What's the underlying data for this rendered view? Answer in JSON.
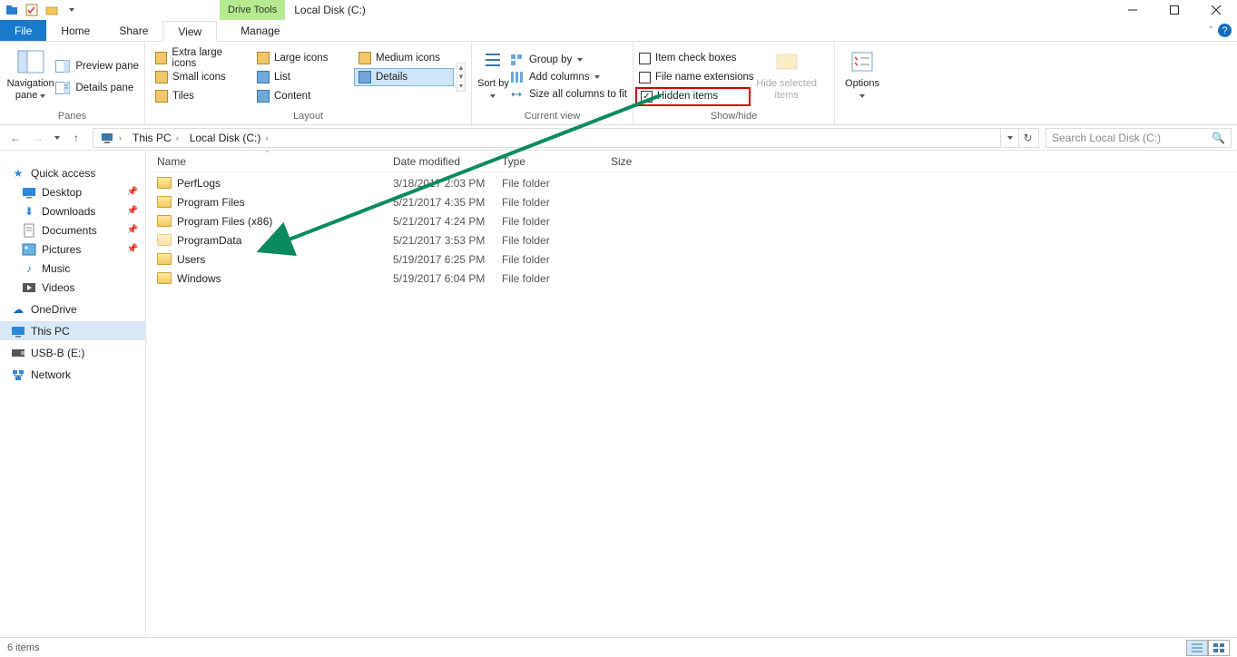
{
  "window": {
    "drive_tools_label": "Drive Tools",
    "title": "Local Disk (C:)"
  },
  "tabs": {
    "file": "File",
    "home": "Home",
    "share": "Share",
    "view": "View",
    "manage": "Manage"
  },
  "ribbon": {
    "panes": {
      "nav_pane": "Navigation pane",
      "preview": "Preview pane",
      "details": "Details pane",
      "group": "Panes"
    },
    "layout": {
      "xl": "Extra large icons",
      "lg": "Large icons",
      "md": "Medium icons",
      "sm": "Small icons",
      "list": "List",
      "details": "Details",
      "tiles": "Tiles",
      "content": "Content",
      "group": "Layout"
    },
    "current_view": {
      "sort_by": "Sort by",
      "group_by": "Group by",
      "add_cols": "Add columns",
      "size_cols": "Size all columns to fit",
      "group": "Current view"
    },
    "show_hide": {
      "item_chk": "Item check boxes",
      "file_ext": "File name extensions",
      "hidden": "Hidden items",
      "hide_sel": "Hide selected items",
      "group": "Show/hide"
    },
    "options": {
      "label": "Options"
    }
  },
  "address": {
    "this_pc": "This PC",
    "location": "Local Disk (C:)"
  },
  "search": {
    "placeholder": "Search Local Disk (C:)"
  },
  "columns": {
    "name": "Name",
    "date": "Date modified",
    "type": "Type",
    "size": "Size"
  },
  "nav": {
    "quick": "Quick access",
    "desktop": "Desktop",
    "downloads": "Downloads",
    "documents": "Documents",
    "pictures": "Pictures",
    "music": "Music",
    "videos": "Videos",
    "onedrive": "OneDrive",
    "this_pc": "This PC",
    "usb": "USB-B (E:)",
    "network": "Network"
  },
  "files": [
    {
      "name": "PerfLogs",
      "date": "3/18/2017 2:03 PM",
      "type": "File folder"
    },
    {
      "name": "Program Files",
      "date": "5/21/2017 4:35 PM",
      "type": "File folder"
    },
    {
      "name": "Program Files (x86)",
      "date": "5/21/2017 4:24 PM",
      "type": "File folder"
    },
    {
      "name": "ProgramData",
      "date": "5/21/2017 3:53 PM",
      "type": "File folder",
      "hidden": true
    },
    {
      "name": "Users",
      "date": "5/19/2017 6:25 PM",
      "type": "File folder"
    },
    {
      "name": "Windows",
      "date": "5/19/2017 6:04 PM",
      "type": "File folder"
    }
  ],
  "status": {
    "count": "6 items"
  }
}
